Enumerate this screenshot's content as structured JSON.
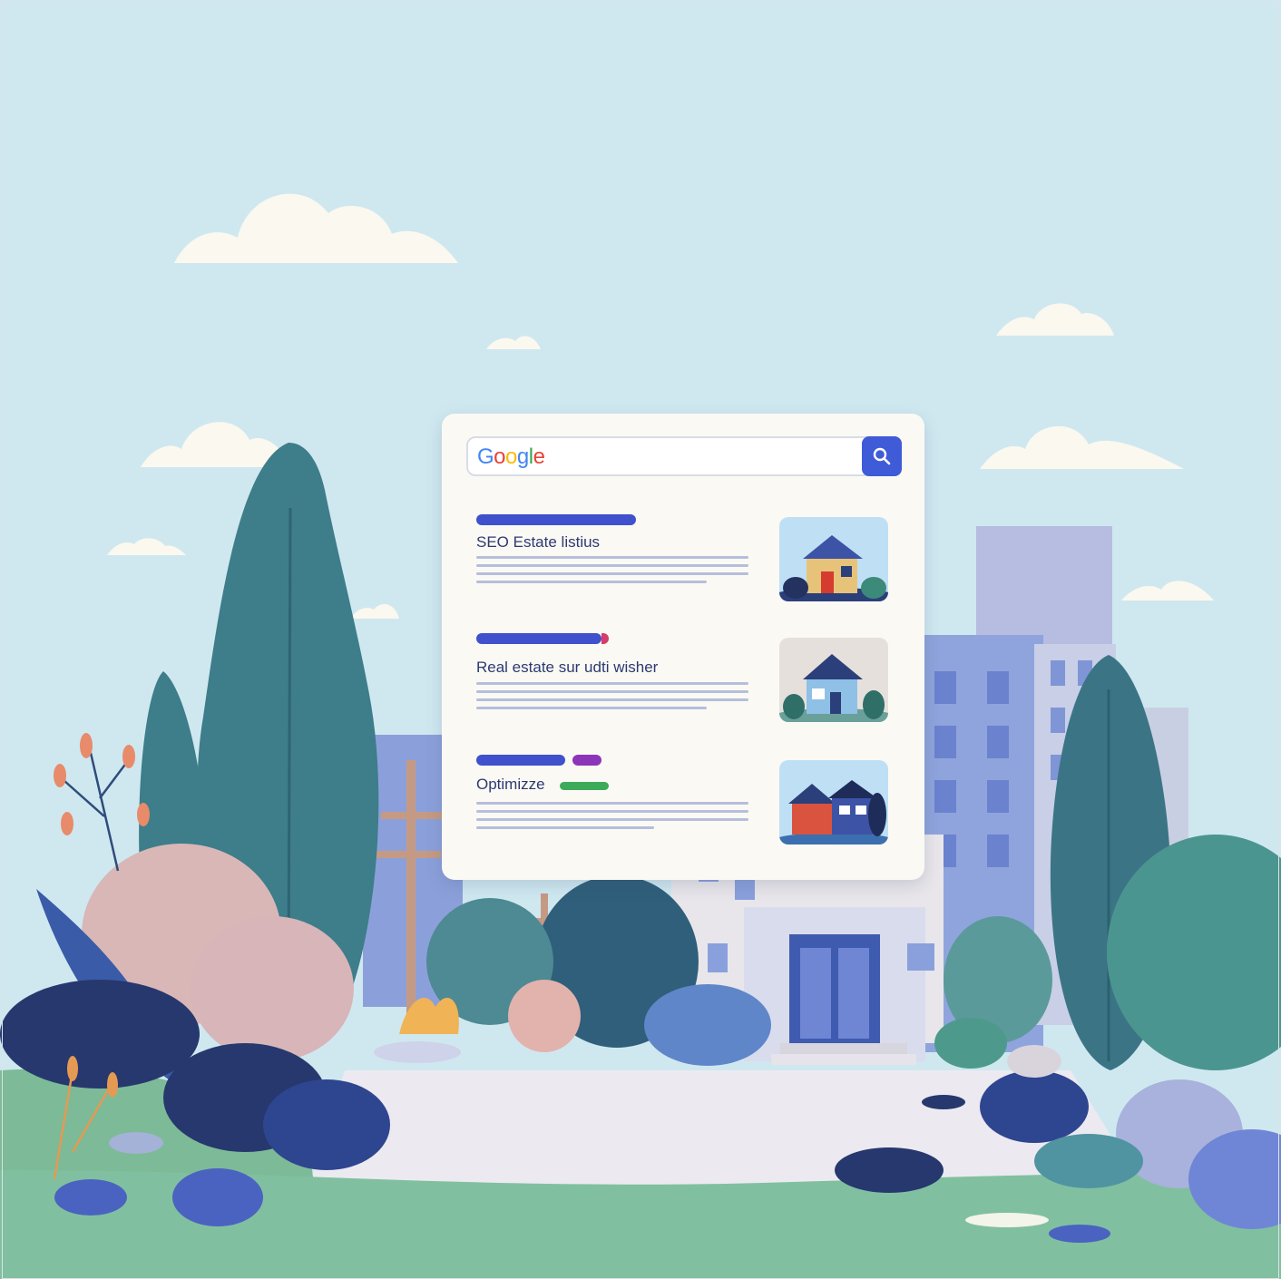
{
  "search": {
    "logo": {
      "letters": [
        "G",
        "o",
        "o",
        "g",
        "l",
        "e"
      ]
    }
  },
  "results": [
    {
      "title": "SEO Estate listius",
      "thumb_icon": "house-icon"
    },
    {
      "title": "Real estate sur udti wisher",
      "thumb_icon": "house-icon"
    },
    {
      "title": "Optimizze",
      "thumb_icon": "house-icon"
    }
  ],
  "colors": {
    "sky": "#cfe8f0",
    "accent_blue": "#3f5bd8",
    "link_bar": "#3f51cc",
    "title_text": "#2d3a72",
    "snippet_line": "#b5bedb",
    "google_blue": "#4285f4",
    "google_red": "#ea4335",
    "google_yellow": "#fbbc05",
    "google_green": "#34a853"
  },
  "icons": [
    "search-icon",
    "house-icon",
    "cloud-icon",
    "tree-icon",
    "building-icon"
  ]
}
